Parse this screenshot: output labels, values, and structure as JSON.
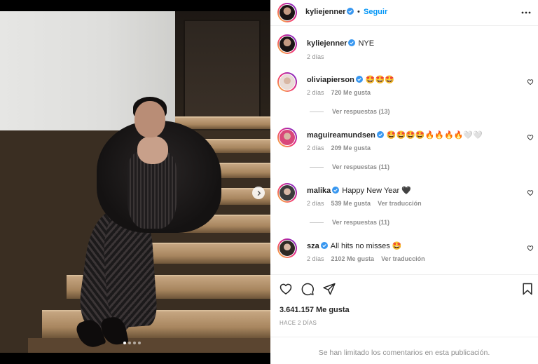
{
  "post": {
    "author": "kyliejenner",
    "follow_label": "Seguir",
    "dot": "•",
    "caption": "NYE",
    "caption_time": "2 días",
    "likes": "3.641.157 Me gusta",
    "time_ago": "HACE 2 DÍAS",
    "comments_limited": "Se han limitado los comentarios en esta publicación."
  },
  "carousel": {
    "total": 4,
    "active": 1
  },
  "comments": [
    {
      "user": "oliviapierson",
      "text": "🤩🤩🤩",
      "time": "2 días",
      "likes": "720 Me gusta",
      "translate": "",
      "replies": "Ver respuestas (13)",
      "avatar_color": "#e9dcd6"
    },
    {
      "user": "maguireamundsen",
      "text": "🤩🤩🤩🤩🔥🔥🔥🔥🤍🤍",
      "time": "2 días",
      "likes": "209 Me gusta",
      "translate": "",
      "replies": "Ver respuestas (11)",
      "avatar_color": "#d9477a"
    },
    {
      "user": "malika",
      "text": "Happy New Year 🖤",
      "time": "2 días",
      "likes": "539 Me gusta",
      "translate": "Ver traducción",
      "replies": "Ver respuestas (11)",
      "avatar_color": "#3b3b3b"
    },
    {
      "user": "sza",
      "text": "All hits no misses 🤩",
      "time": "2 días",
      "likes": "2102 Me gusta",
      "translate": "Ver traducción",
      "replies": "",
      "avatar_color": "#2e2a24"
    }
  ],
  "icons": {
    "verified": "verified-badge-icon",
    "more": "more-options-icon",
    "like": "heart-icon",
    "comment": "comment-icon",
    "share": "share-icon",
    "save": "bookmark-icon",
    "next": "chevron-right-icon"
  },
  "colors": {
    "accent": "#0095f6",
    "verified": "#3897f0",
    "muted": "#8e8e8e"
  }
}
